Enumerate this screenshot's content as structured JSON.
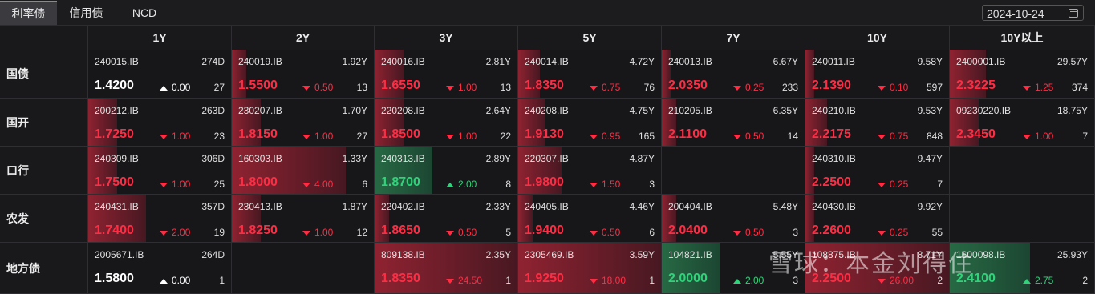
{
  "tabs": [
    {
      "label": "利率债",
      "active": true
    },
    {
      "label": "信用债",
      "active": false
    },
    {
      "label": "NCD",
      "active": false
    }
  ],
  "date": "2024-10-24",
  "columns": [
    "1Y",
    "2Y",
    "3Y",
    "5Y",
    "7Y",
    "10Y",
    "10Y以上"
  ],
  "rows": [
    {
      "label": "国债",
      "cells": [
        {
          "code": "240015.IB",
          "term": "274D",
          "yield": "1.4200",
          "change": "0.00",
          "volume": "27",
          "dir": "neu",
          "intensity": 0
        },
        {
          "code": "240019.IB",
          "term": "1.92Y",
          "yield": "1.5500",
          "change": "0.50",
          "volume": "13",
          "dir": "up",
          "intensity": 0.1
        },
        {
          "code": "240016.IB",
          "term": "2.81Y",
          "yield": "1.6550",
          "change": "1.00",
          "volume": "13",
          "dir": "up",
          "intensity": 0.2
        },
        {
          "code": "240014.IB",
          "term": "4.72Y",
          "yield": "1.8350",
          "change": "0.75",
          "volume": "76",
          "dir": "up",
          "intensity": 0.15
        },
        {
          "code": "240013.IB",
          "term": "6.67Y",
          "yield": "2.0350",
          "change": "0.25",
          "volume": "233",
          "dir": "up",
          "intensity": 0.06
        },
        {
          "code": "240011.IB",
          "term": "9.58Y",
          "yield": "2.1390",
          "change": "0.10",
          "volume": "597",
          "dir": "up",
          "intensity": 0.03
        },
        {
          "code": "2400001.IB",
          "term": "29.57Y",
          "yield": "2.3225",
          "change": "1.25",
          "volume": "374",
          "dir": "up",
          "intensity": 0.25
        }
      ]
    },
    {
      "label": "国开",
      "cells": [
        {
          "code": "200212.IB",
          "term": "263D",
          "yield": "1.7250",
          "change": "1.00",
          "volume": "23",
          "dir": "up",
          "intensity": 0.2
        },
        {
          "code": "230207.IB",
          "term": "1.70Y",
          "yield": "1.8150",
          "change": "1.00",
          "volume": "27",
          "dir": "up",
          "intensity": 0.2
        },
        {
          "code": "220208.IB",
          "term": "2.64Y",
          "yield": "1.8500",
          "change": "1.00",
          "volume": "22",
          "dir": "up",
          "intensity": 0.2
        },
        {
          "code": "240208.IB",
          "term": "4.75Y",
          "yield": "1.9130",
          "change": "0.95",
          "volume": "165",
          "dir": "up",
          "intensity": 0.19
        },
        {
          "code": "210205.IB",
          "term": "6.35Y",
          "yield": "2.1100",
          "change": "0.50",
          "volume": "14",
          "dir": "up",
          "intensity": 0.1
        },
        {
          "code": "240210.IB",
          "term": "9.53Y",
          "yield": "2.2175",
          "change": "0.75",
          "volume": "848",
          "dir": "up",
          "intensity": 0.15
        },
        {
          "code": "09230220.IB",
          "term": "18.75Y",
          "yield": "2.3450",
          "change": "1.00",
          "volume": "7",
          "dir": "up",
          "intensity": 0.2
        }
      ]
    },
    {
      "label": "口行",
      "cells": [
        {
          "code": "240309.IB",
          "term": "306D",
          "yield": "1.7500",
          "change": "1.00",
          "volume": "25",
          "dir": "up",
          "intensity": 0.2
        },
        {
          "code": "160303.IB",
          "term": "1.33Y",
          "yield": "1.8000",
          "change": "4.00",
          "volume": "6",
          "dir": "up",
          "intensity": 0.8
        },
        {
          "code": "240313.IB",
          "term": "2.89Y",
          "yield": "1.8700",
          "change": "2.00",
          "volume": "8",
          "dir": "dn",
          "intensity": 0.4
        },
        {
          "code": "220307.IB",
          "term": "4.87Y",
          "yield": "1.9800",
          "change": "1.50",
          "volume": "3",
          "dir": "up",
          "intensity": 0.3
        },
        null,
        {
          "code": "240310.IB",
          "term": "9.47Y",
          "yield": "2.2500",
          "change": "0.25",
          "volume": "7",
          "dir": "up",
          "intensity": 0.05
        },
        null
      ]
    },
    {
      "label": "农发",
      "cells": [
        {
          "code": "240431.IB",
          "term": "357D",
          "yield": "1.7400",
          "change": "2.00",
          "volume": "19",
          "dir": "up",
          "intensity": 0.4
        },
        {
          "code": "230413.IB",
          "term": "1.87Y",
          "yield": "1.8250",
          "change": "1.00",
          "volume": "12",
          "dir": "up",
          "intensity": 0.2
        },
        {
          "code": "220402.IB",
          "term": "2.33Y",
          "yield": "1.8650",
          "change": "0.50",
          "volume": "5",
          "dir": "up",
          "intensity": 0.1
        },
        {
          "code": "240405.IB",
          "term": "4.46Y",
          "yield": "1.9400",
          "change": "0.50",
          "volume": "6",
          "dir": "up",
          "intensity": 0.1
        },
        {
          "code": "200404.IB",
          "term": "5.48Y",
          "yield": "2.0400",
          "change": "0.50",
          "volume": "3",
          "dir": "up",
          "intensity": 0.1
        },
        {
          "code": "240430.IB",
          "term": "9.92Y",
          "yield": "2.2600",
          "change": "0.25",
          "volume": "55",
          "dir": "up",
          "intensity": 0.05
        },
        null
      ]
    },
    {
      "label": "地方债",
      "cells": [
        {
          "code": "2005671.IB",
          "term": "264D",
          "yield": "1.5800",
          "change": "0.00",
          "volume": "1",
          "dir": "neu",
          "intensity": 0
        },
        null,
        {
          "code": "809138.IB",
          "term": "2.35Y",
          "yield": "1.8350",
          "change": "24.50",
          "volume": "1",
          "dir": "up",
          "intensity": 1
        },
        {
          "code": "2305469.IB",
          "term": "3.59Y",
          "yield": "1.9250",
          "change": "18.00",
          "volume": "1",
          "dir": "up",
          "intensity": 1
        },
        {
          "code": "104821.IB",
          "term": "5.55Y",
          "yield": "2.0000",
          "change": "2.00",
          "volume": "3",
          "dir": "dn",
          "intensity": 0.4
        },
        {
          "code": "108875.IB",
          "term": "8.71Y",
          "yield": "2.2500",
          "change": "26.00",
          "volume": "2",
          "dir": "up",
          "intensity": 1
        },
        {
          "code": "1600098.IB",
          "term": "25.93Y",
          "yield": "2.4100",
          "change": "2.75",
          "volume": "2",
          "dir": "dn",
          "intensity": 0.55
        }
      ]
    }
  ],
  "watermark": "雪球：本金刘得住",
  "colors": {
    "up": "#ff2d44",
    "down": "#2fd37a",
    "neutral": "#ffffff",
    "bg": "#151518"
  }
}
